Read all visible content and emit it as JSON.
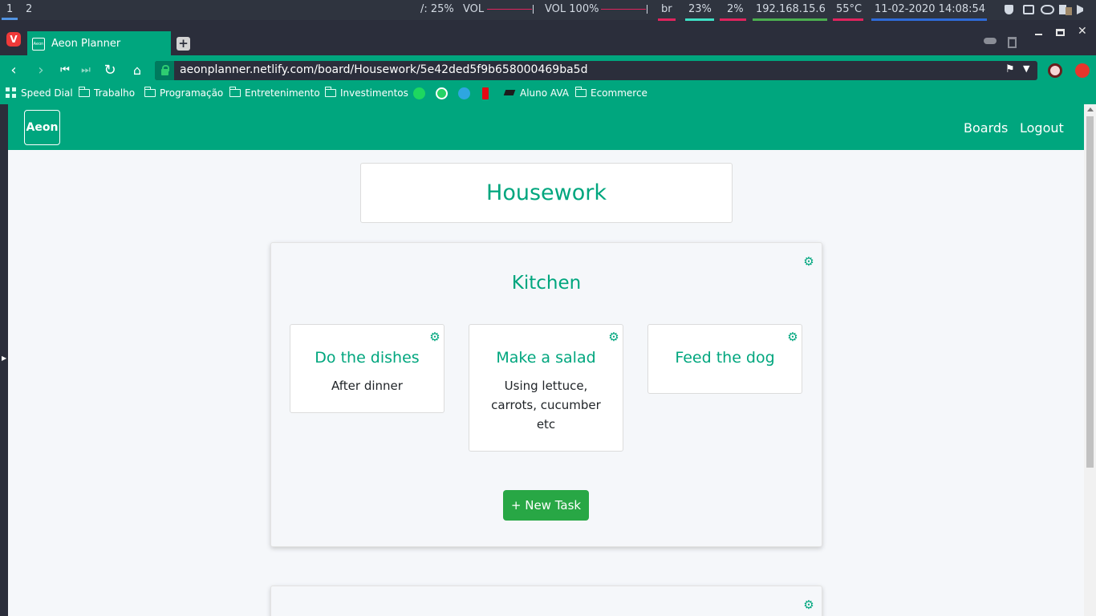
{
  "statusbar": {
    "workspace_1": "1",
    "workspace_2": "2",
    "brightness": "/: 25%",
    "vol_label": "VOL",
    "vol_pct": "VOL 100%",
    "keyboard": "br",
    "cpu": "23%",
    "mem": "2%",
    "ip": "192.168.15.6",
    "temp": "55°C",
    "datetime": "11-02-2020 14:08:54"
  },
  "browser": {
    "tab_title": "Aeon Planner",
    "url": "aeonplanner.netlify.com/board/Housework/5e42ded5f9b658000469ba5d",
    "bookmarks": [
      "Speed Dial",
      "Trabalho",
      "Programação",
      "Entretenimento",
      "Investimentos",
      "Aluno AVA",
      "Ecommerce"
    ]
  },
  "app": {
    "brand": "Aeon",
    "nav_boards": "Boards",
    "nav_logout": "Logout",
    "board_title": "Housework",
    "list_title": "Kitchen",
    "tasks": [
      {
        "title": "Do the dishes",
        "description": "After dinner"
      },
      {
        "title": "Make a salad",
        "description": "Using lettuce, carrots, cucumber etc"
      },
      {
        "title": "Feed the dog",
        "description": ""
      }
    ],
    "new_task_label": "+ New Task"
  },
  "colors": {
    "accent": "#00a67e",
    "button": "#28a745",
    "page_bg": "#f5f7fa"
  },
  "icons": {
    "settings": "gear-icon"
  }
}
